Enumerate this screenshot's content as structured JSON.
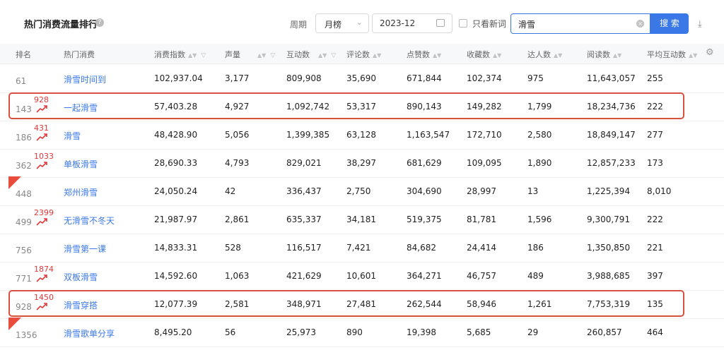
{
  "header": {
    "title": "热门消费流量排行",
    "period_label": "周期",
    "period_value": "月榜",
    "date_value": "2023-12",
    "only_new_label": "只看新词",
    "search_value": "滑雪",
    "search_button": "搜 索"
  },
  "columns": [
    "排名",
    "热门消费",
    "消费指数",
    "声量",
    "互动数",
    "评论数",
    "点赞数",
    "收藏数",
    "达人数",
    "阅读数",
    "平均互动数"
  ],
  "rows": [
    {
      "rank": "61",
      "trend": "",
      "is_new": false,
      "keyword": "滑雪时间到",
      "index": "102,937.04",
      "volume": "3,177",
      "interactions": "809,908",
      "comments": "35,690",
      "likes": "671,844",
      "favorites": "102,374",
      "creators": "975",
      "reads": "11,643,057",
      "avg": "255"
    },
    {
      "rank": "143",
      "trend": "928",
      "is_new": false,
      "keyword": "一起滑雪",
      "index": "57,403.28",
      "volume": "4,927",
      "interactions": "1,092,742",
      "comments": "53,317",
      "likes": "890,143",
      "favorites": "149,282",
      "creators": "1,799",
      "reads": "18,234,736",
      "avg": "222"
    },
    {
      "rank": "186",
      "trend": "431",
      "is_new": false,
      "keyword": "滑雪",
      "index": "48,428.90",
      "volume": "5,056",
      "interactions": "1,399,385",
      "comments": "63,128",
      "likes": "1,163,547",
      "favorites": "172,710",
      "creators": "2,580",
      "reads": "18,849,147",
      "avg": "277"
    },
    {
      "rank": "362",
      "trend": "1033",
      "is_new": false,
      "keyword": "单板滑雪",
      "index": "28,690.33",
      "volume": "4,793",
      "interactions": "829,021",
      "comments": "38,297",
      "likes": "681,629",
      "favorites": "109,095",
      "creators": "1,890",
      "reads": "12,857,233",
      "avg": "173"
    },
    {
      "rank": "448",
      "trend": "",
      "is_new": true,
      "keyword": "郑州滑雪",
      "index": "24,050.24",
      "volume": "42",
      "interactions": "336,437",
      "comments": "2,750",
      "likes": "304,690",
      "favorites": "28,997",
      "creators": "13",
      "reads": "1,225,394",
      "avg": "8,010"
    },
    {
      "rank": "499",
      "trend": "2399",
      "is_new": false,
      "keyword": "无滑雪不冬天",
      "index": "21,987.97",
      "volume": "2,861",
      "interactions": "635,337",
      "comments": "34,181",
      "likes": "519,375",
      "favorites": "81,781",
      "creators": "1,596",
      "reads": "9,300,791",
      "avg": "222"
    },
    {
      "rank": "756",
      "trend": "",
      "is_new": false,
      "keyword": "滑雪第一课",
      "index": "14,833.31",
      "volume": "528",
      "interactions": "116,517",
      "comments": "7,421",
      "likes": "84,682",
      "favorites": "24,414",
      "creators": "186",
      "reads": "1,350,850",
      "avg": "221"
    },
    {
      "rank": "771",
      "trend": "1874",
      "is_new": false,
      "keyword": "双板滑雪",
      "index": "14,592.60",
      "volume": "1,063",
      "interactions": "421,629",
      "comments": "10,601",
      "likes": "364,271",
      "favorites": "46,757",
      "creators": "489",
      "reads": "3,988,685",
      "avg": "397"
    },
    {
      "rank": "928",
      "trend": "1450",
      "is_new": false,
      "keyword": "滑雪穿搭",
      "index": "12,077.39",
      "volume": "2,581",
      "interactions": "348,971",
      "comments": "27,481",
      "likes": "262,544",
      "favorites": "58,946",
      "creators": "1,261",
      "reads": "7,753,319",
      "avg": "135"
    },
    {
      "rank": "1356",
      "trend": "",
      "is_new": true,
      "keyword": "滑雪歌单分享",
      "index": "8,495.20",
      "volume": "56",
      "interactions": "25,973",
      "comments": "890",
      "likes": "19,398",
      "favorites": "5,685",
      "creators": "29",
      "reads": "260,857",
      "avg": "464"
    }
  ],
  "highlighted_rows": [
    1,
    8
  ],
  "colors": {
    "accent": "#3b78e7",
    "trend_up": "#e0383a",
    "highlight": "#d9503e"
  }
}
